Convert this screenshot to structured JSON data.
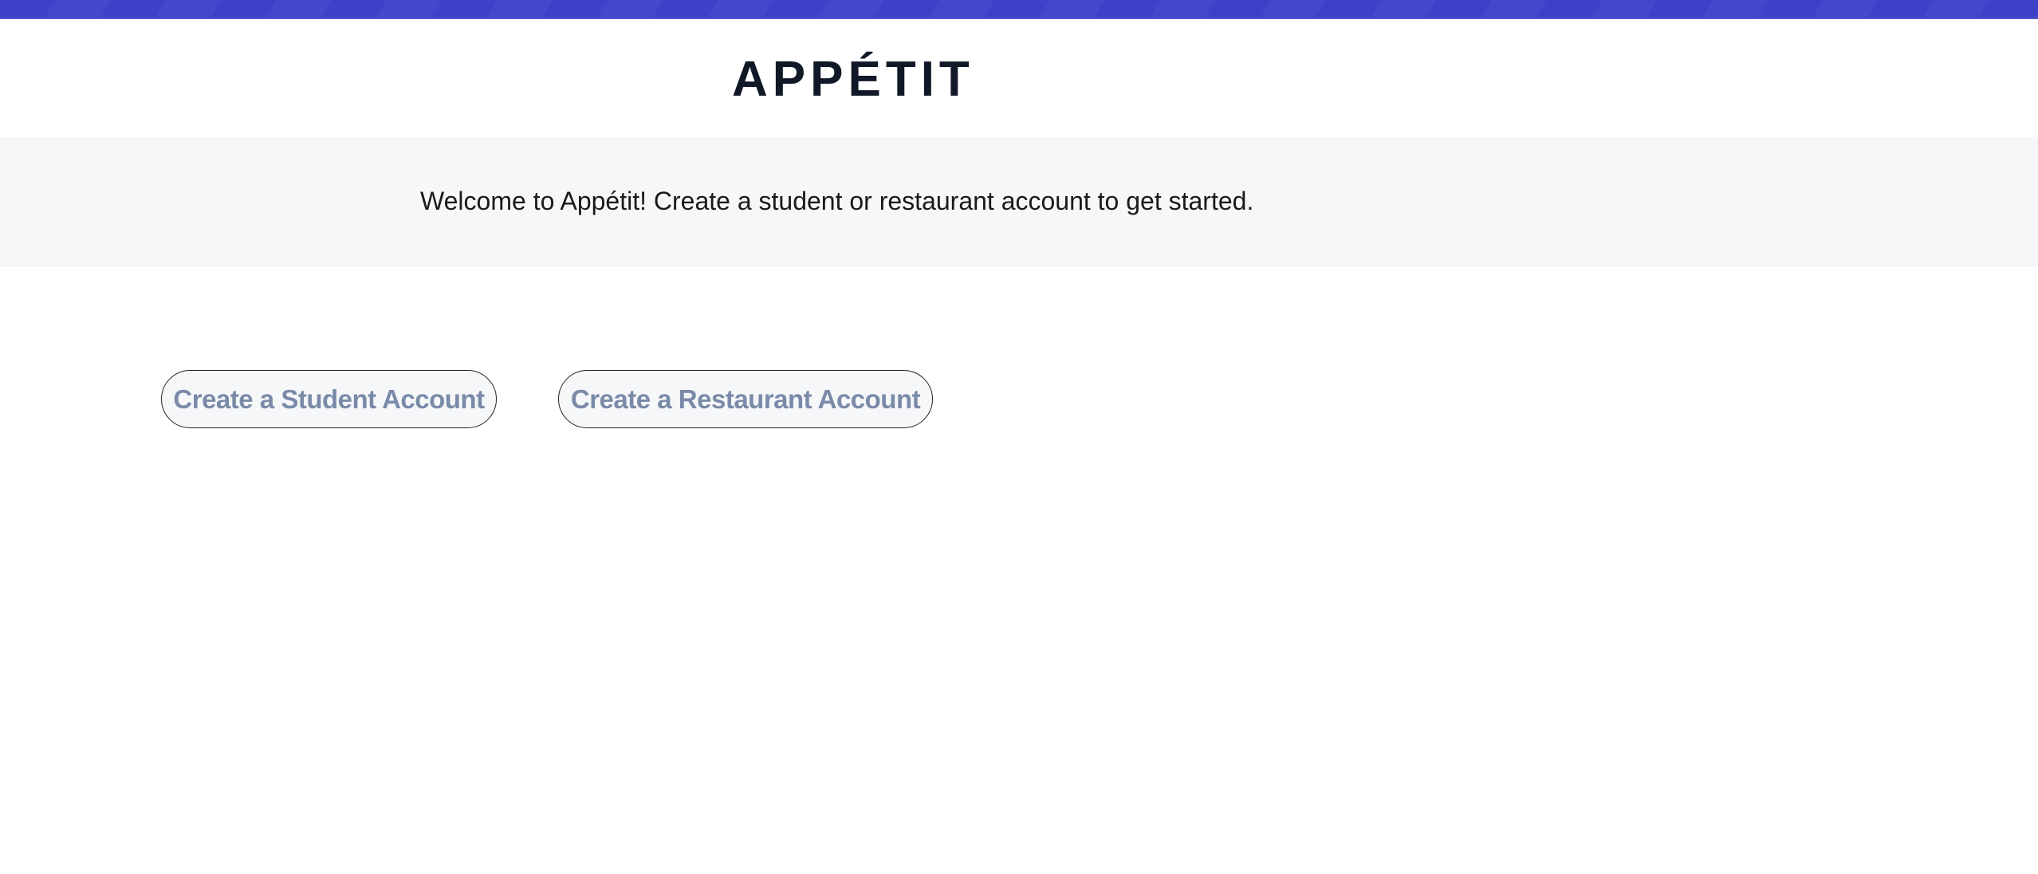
{
  "colors": {
    "topbar": "#3d41c8",
    "title": "#111827",
    "button_text": "#7a8aa8",
    "band": "#f6f7f9"
  },
  "header": {
    "title": "APPÉTIT"
  },
  "banner": {
    "welcome": "Welcome to Appétit! Create a student or restaurant account to get started."
  },
  "actions": {
    "student_label": "Create a Student Account",
    "restaurant_label": "Create a Restaurant Account"
  }
}
